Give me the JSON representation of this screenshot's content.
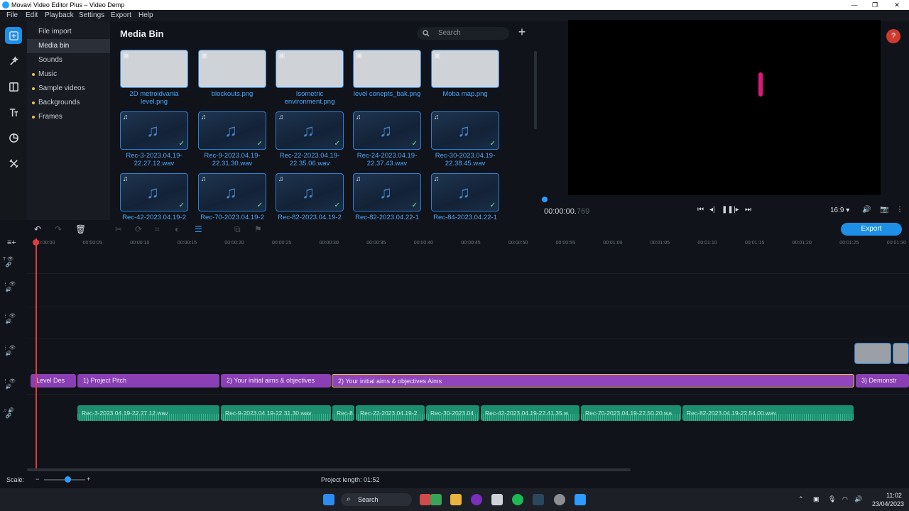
{
  "window": {
    "title": "Movavi Video Editor Plus – Video Demp"
  },
  "menu": [
    "File",
    "Edit",
    "Playback",
    "Settings",
    "Export",
    "Help"
  ],
  "toolrail": [
    "import-icon",
    "magic-icon",
    "transitions-icon",
    "titles-icon",
    "stickers-icon",
    "tools-icon"
  ],
  "sidebar": {
    "items": [
      {
        "label": "File import"
      },
      {
        "label": "Media bin"
      },
      {
        "label": "Sounds"
      },
      {
        "label": "Music"
      },
      {
        "label": "Sample videos"
      },
      {
        "label": "Backgrounds"
      },
      {
        "label": "Frames"
      }
    ]
  },
  "mediabin": {
    "title": "Media Bin",
    "search_placeholder": "Search",
    "tiles": [
      {
        "name": "2D metroidvania level.png",
        "type": "image"
      },
      {
        "name": "blockouts.png",
        "type": "image"
      },
      {
        "name": "Isometric environment.png",
        "type": "image"
      },
      {
        "name": "level conepts_bak.png",
        "type": "image"
      },
      {
        "name": "Moba map.png",
        "type": "image"
      },
      {
        "name": "Rec-3-2023.04.19-22.27.12.wav",
        "type": "audio"
      },
      {
        "name": "Rec-9-2023.04.19-22.31.30.wav",
        "type": "audio"
      },
      {
        "name": "Rec-22-2023.04.19-22.35.06.wav",
        "type": "audio"
      },
      {
        "name": "Rec-24-2023.04.19-22.37.43.wav",
        "type": "audio"
      },
      {
        "name": "Rec-30-2023.04.19-22.38.45.wav",
        "type": "audio"
      },
      {
        "name": "Rec-42-2023.04.19-2",
        "type": "audio"
      },
      {
        "name": "Rec-70-2023.04.19-2",
        "type": "audio"
      },
      {
        "name": "Rec-82-2023.04.19-2",
        "type": "audio"
      },
      {
        "name": "Rec-82-2023.04.22-1",
        "type": "audio"
      },
      {
        "name": "Rec-84-2023.04.22-1",
        "type": "audio"
      }
    ]
  },
  "player": {
    "timecode": "00:00:00",
    "timecode_ms": "769",
    "aspect": "16:9"
  },
  "toolbar": {
    "export_label": "Export"
  },
  "ruler": [
    "00:00:00",
    "00:00:05",
    "00:00:10",
    "00:00:15",
    "00:00:20",
    "00:00:25",
    "00:00:30",
    "00:00:35",
    "00:00:40",
    "00:00:45",
    "00:00:50",
    "00:00:55",
    "00:01:00",
    "00:01:05",
    "00:01:10",
    "00:01:15",
    "00:01:20",
    "00:01:25",
    "00:01:30"
  ],
  "timeline": {
    "title_clips": [
      {
        "label": "Level Des"
      },
      {
        "label": "1) Project Pitch"
      },
      {
        "label": "2) Your initial aims & objectives"
      },
      {
        "label": "2) Your initial aims & objectives Aims"
      },
      {
        "label": "3) Demonstr"
      }
    ],
    "audio_clips": [
      {
        "label": "Rec-3-2023.04.19-22.27.12.wav"
      },
      {
        "label": "Rec-9-2023.04.19-22.31.30.wav"
      },
      {
        "label": "Rec-8"
      },
      {
        "label": "Rec-22-2023.04.19-2"
      },
      {
        "label": "Rec-30-2023.04"
      },
      {
        "label": "Rec-42-2023.04.19-22.41.35.w"
      },
      {
        "label": "Rec-70-2023.04.19-22.50.20.wa"
      },
      {
        "label": "Rec-82-2023.04.19-22.54.00.wav"
      }
    ]
  },
  "bottom": {
    "scale_label": "Scale:",
    "project_length": "Project length: 01:52"
  },
  "taskbar": {
    "search": "Search",
    "time": "11:02",
    "date": "23/04/2023"
  }
}
